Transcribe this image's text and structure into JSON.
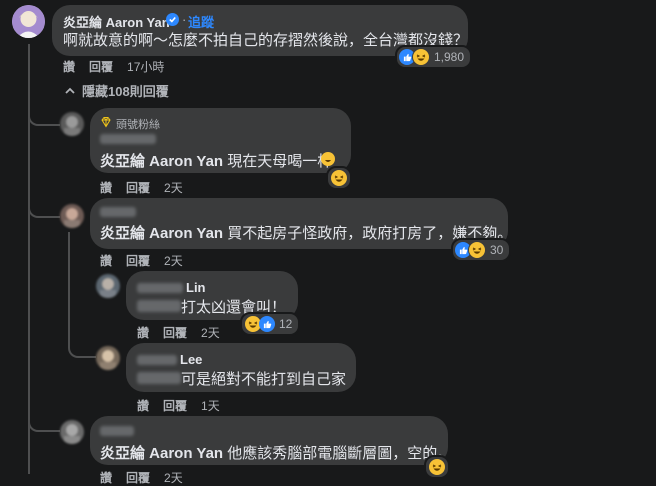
{
  "main_comment": {
    "author": "炎亞綸 Aaron Yan",
    "follow_label": "追蹤",
    "text": "啊就故意的啊～怎麼不拍自己的存摺然後說，全台灣都沒錢？",
    "like_label": "讚",
    "reply_label": "回覆",
    "time": "17小時",
    "reaction_count": "1,980",
    "hidden_replies_label": "隱藏108則回覆"
  },
  "replies": [
    {
      "badge": "頭號粉絲",
      "mention": "炎亞綸 Aaron Yan",
      "text": " 現在天母喝一杯",
      "like_label": "讚",
      "reply_label": "回覆",
      "time": "2天"
    },
    {
      "mention": "炎亞綸 Aaron Yan",
      "text": " 買不起房子怪政府，政府打房了，嫌不夠。",
      "like_label": "讚",
      "reply_label": "回覆",
      "time": "2天",
      "reaction_count": "30"
    },
    {
      "name_suffix": "Lin",
      "text": " 打太凶還會叫！",
      "like_label": "讚",
      "reply_label": "回覆",
      "time": "2天",
      "reaction_count": "12"
    },
    {
      "name_suffix": "Lee",
      "text": " 可是絕對不能打到自己家",
      "like_label": "讚",
      "reply_label": "回覆",
      "time": "1天"
    },
    {
      "mention": "炎亞綸 Aaron Yan",
      "text": " 他應該秀腦部電腦斷層圖，空的。",
      "like_label": "讚",
      "reply_label": "回覆",
      "time": "2天"
    }
  ]
}
